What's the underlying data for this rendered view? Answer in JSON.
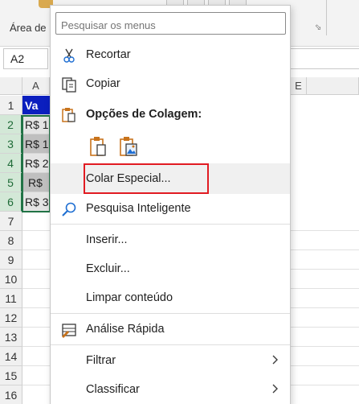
{
  "ribbon": {
    "clipboard_label": "Área de",
    "launcher_glyph": "⬂"
  },
  "name_box": {
    "value": "A2"
  },
  "columns": {
    "a": "A",
    "e": "E"
  },
  "rows": [
    {
      "number": "1",
      "cell": "Va"
    },
    {
      "number": "2",
      "cell": "R$ 1"
    },
    {
      "number": "3",
      "cell": "R$ 1"
    },
    {
      "number": "4",
      "cell": "R$ 2"
    },
    {
      "number": "5",
      "cell": "R$"
    },
    {
      "number": "6",
      "cell": "R$ 3"
    },
    {
      "number": "7",
      "cell": ""
    },
    {
      "number": "8",
      "cell": ""
    },
    {
      "number": "9",
      "cell": ""
    },
    {
      "number": "10",
      "cell": ""
    },
    {
      "number": "11",
      "cell": ""
    },
    {
      "number": "12",
      "cell": ""
    },
    {
      "number": "13",
      "cell": ""
    },
    {
      "number": "14",
      "cell": ""
    },
    {
      "number": "15",
      "cell": ""
    },
    {
      "number": "16",
      "cell": ""
    }
  ],
  "context_menu": {
    "search_placeholder": "Pesquisar os menus",
    "cut": "Recortar",
    "copy": "Copiar",
    "paste_options": "Opções de Colagem:",
    "paste_special": "Colar Especial...",
    "smart_lookup": "Pesquisa Inteligente",
    "insert": "Inserir...",
    "delete": "Excluir...",
    "clear_contents": "Limpar conteúdo",
    "quick_analysis": "Análise Rápida",
    "filter": "Filtrar",
    "sort": "Classificar"
  },
  "colors": {
    "header_fill": "#0b1fbf",
    "selection": "#217346",
    "highlight_box": "#e11b22",
    "icon_orange": "#c8731c",
    "icon_blue": "#1e6ed2"
  }
}
